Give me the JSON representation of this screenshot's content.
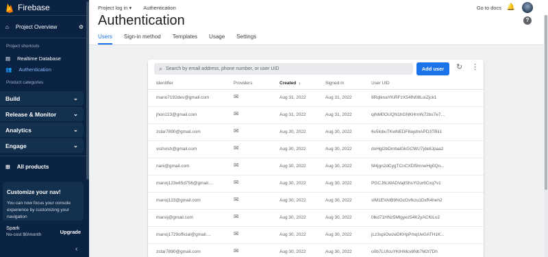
{
  "sidebar": {
    "brand": "Firebase",
    "overview_label": "Project Overview",
    "shortcuts_heading": "Project shortcuts",
    "shortcuts": [
      {
        "label": "Realtime Database",
        "icon": "database-icon"
      },
      {
        "label": "Authentication",
        "icon": "people-icon",
        "active": true
      }
    ],
    "categories_heading": "Product categories",
    "categories": [
      {
        "label": "Build"
      },
      {
        "label": "Release & Monitor"
      },
      {
        "label": "Analytics"
      },
      {
        "label": "Engage"
      }
    ],
    "all_products": "All products",
    "customize_title": "Customize your nav!",
    "customize_body": "You can now focus your console experience by customizing your navigation",
    "plan_name": "Spark",
    "plan_sub": "No-cost $0/month",
    "upgrade_label": "Upgrade"
  },
  "topbar": {
    "project": "Project log in",
    "crumb": "Authentication",
    "docs": "Go to docs"
  },
  "header": {
    "title": "Authentication",
    "tabs": [
      "Users",
      "Sign-in method",
      "Templates",
      "Usage",
      "Settings"
    ],
    "active_tab": "Users"
  },
  "users": {
    "search_placeholder": "Search by email address, phone number, or user UID",
    "add_user": "Add user",
    "columns": {
      "identifier": "Identifier",
      "providers": "Providers",
      "created": "Created",
      "signed_in": "Signed In",
      "uid": "User UID"
    },
    "rows": [
      {
        "id": "mano7192dev@gmail.com",
        "created": "Aug 31, 2022",
        "signed": "Aug 31, 2022",
        "uid": "6RqlknaYKiRFzX54fN08LoiZjck1"
      },
      {
        "id": "jhon123@gmail.com",
        "created": "Aug 31, 2022",
        "signed": "Aug 31, 2022",
        "uid": "qiNM0OUQN1hGNKHrmN72bs7e7..."
      },
      {
        "id": "zstar7890@gmail.com",
        "created": "Aug 30, 2022",
        "signed": "Aug 30, 2022",
        "uid": "6v5lobuTKwNEDF8aydnAPD3TBii1"
      },
      {
        "id": "vishvish@gmail.com",
        "created": "Aug 30, 2022",
        "signed": "Aug 30, 2022",
        "uid": "doHgl2bDmbalGkGCWU7jde8Jpaa2"
      },
      {
        "id": "nani@gmail.com",
        "created": "Aug 30, 2022",
        "signed": "Aug 30, 2022",
        "uid": "M4jgn2dCygTCnCXDf9mneHg0Qn..."
      },
      {
        "id": "manoj123e65d756@gmail....",
        "created": "Aug 30, 2022",
        "signed": "Aug 30, 2022",
        "uid": "PGCJ6LWADVajtShsYl2ur6Cxq7v1"
      },
      {
        "id": "manoj123@gmail.com",
        "created": "Aug 30, 2022",
        "signed": "Aug 30, 2022",
        "uid": "slM1EVAtB9NGcGvfkzu1DxR4heh2"
      },
      {
        "id": "manoj@gmail.com",
        "created": "Aug 30, 2022",
        "signed": "Aug 30, 2022",
        "uid": "0lkd71HNz5Mlgyez54K2yACKiLo2"
      },
      {
        "id": "manoj1729official@gmail....",
        "created": "Aug 30, 2022",
        "signed": "Aug 30, 2022",
        "uid": "jLz3spiOwzeDKHpPmqUeGATH1K..."
      },
      {
        "id": "zstar7890@gmail.com",
        "created": "Aug 30, 2022",
        "signed": "Aug 30, 2022",
        "uid": "o0b7LUfcuYKtHMcv8Nb7M2t7Dh"
      }
    ]
  },
  "colors": {
    "sidebar_bg": "#0b2342",
    "accent": "#1a73e8"
  }
}
